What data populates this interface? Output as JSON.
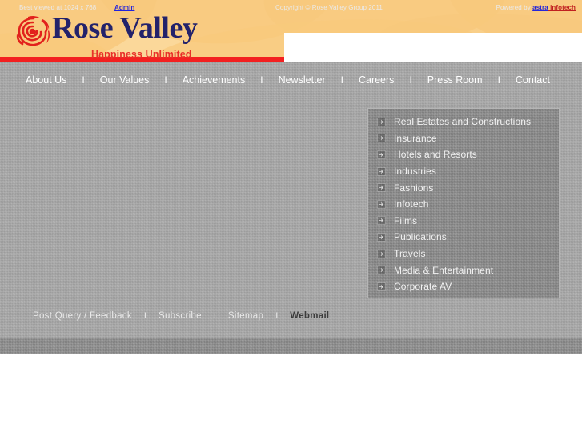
{
  "site": {
    "logo_name": "Rose Valley",
    "logo_tagline": "Happiness Unlimited",
    "rose_icon": "rose-icon"
  },
  "nav": {
    "separator": "I",
    "items": [
      {
        "label": "About Us"
      },
      {
        "label": "Our Values"
      },
      {
        "label": "Achievements"
      },
      {
        "label": "Newsletter"
      },
      {
        "label": "Careers"
      },
      {
        "label": "Press Room"
      },
      {
        "label": "Contact"
      }
    ]
  },
  "side_menu": {
    "arrow_icon": "arrow-right-icon",
    "items": [
      {
        "label": "Real Estates and Constructions"
      },
      {
        "label": "Insurance"
      },
      {
        "label": "Hotels and Resorts"
      },
      {
        "label": "Industries"
      },
      {
        "label": "Fashions"
      },
      {
        "label": "Infotech"
      },
      {
        "label": "Films"
      },
      {
        "label": "Publications"
      },
      {
        "label": "Travels"
      },
      {
        "label": "Media & Entertainment"
      },
      {
        "label": "Corporate AV"
      }
    ]
  },
  "footer": {
    "separator": "I",
    "links": [
      {
        "label": "Post Query / Feedback"
      },
      {
        "label": "Subscribe"
      },
      {
        "label": "Sitemap"
      },
      {
        "label": "Webmail"
      }
    ]
  },
  "bottom_bar": {
    "best_viewed": "Best viewed at 1024 x 768",
    "admin_label": "Admin",
    "copyright": "Copyright © Rose Valley Group 2011",
    "powered_by_prefix": "Powered by ",
    "powered_by_brand_1": "astra",
    "powered_by_brand_2": " infotech"
  },
  "colors": {
    "header_bg": "#fbd89a",
    "header_wave": "#f8c97c",
    "red_stripe": "#f32020",
    "logo_blue": "#23226b",
    "logo_red": "#e8302a",
    "nav_bg": "#a8a8a8",
    "panel_bg": "#8d8d8d",
    "bottom_bar_bg": "#909090",
    "link_blue": "#2222dd"
  }
}
